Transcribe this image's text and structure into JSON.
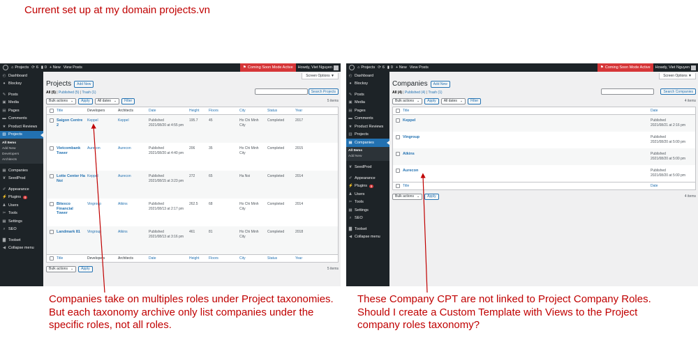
{
  "annotations": {
    "top_note": "Current set up at my domain projects.vn",
    "left_note": "Companies take on multiples roles under Project taxonomies. But each taxonomy archive only list companies under the specific roles, not all roles.",
    "right_note": "These Company CPT are not linked to Project Company Roles. Should I create a Custom Template with Views to the Project company roles taxonomy?",
    "color": "#c00000"
  },
  "adminbar": {
    "site": "Projects",
    "updates": "6",
    "comments": "0",
    "new": "+ New",
    "view_posts": "View Posts",
    "coming_soon": "Coming Soon Mode Active",
    "howdy": "Howdy, Viet Nguyen"
  },
  "sidebar": {
    "items": [
      {
        "label": "Dashboard",
        "icon": "dashboard-icon"
      },
      {
        "label": "Blocksy",
        "icon": "blocksy-icon"
      },
      {
        "label": "Posts",
        "icon": "pin-icon"
      },
      {
        "label": "Media",
        "icon": "media-icon"
      },
      {
        "label": "Pages",
        "icon": "pages-icon"
      },
      {
        "label": "Comments",
        "icon": "comment-icon"
      },
      {
        "label": "Product Reviews",
        "icon": "star-icon"
      },
      {
        "label": "Projects",
        "icon": "projects-icon"
      },
      {
        "label": "Companies",
        "icon": "companies-icon"
      },
      {
        "label": "SeedProd",
        "icon": "seedprod-icon"
      },
      {
        "label": "Appearance",
        "icon": "brush-icon"
      },
      {
        "label": "Plugins",
        "icon": "plugin-icon",
        "badge": "6"
      },
      {
        "label": "Users",
        "icon": "users-icon"
      },
      {
        "label": "Tools",
        "icon": "wrench-icon"
      },
      {
        "label": "Settings",
        "icon": "settings-icon"
      },
      {
        "label": "SEO",
        "icon": "seo-icon"
      },
      {
        "label": "Toolset",
        "icon": "toolset-icon"
      },
      {
        "label": "Collapse menu",
        "icon": "collapse-icon"
      }
    ],
    "projects_sub": [
      "All Items",
      "Add New",
      "Developers",
      "Architects"
    ],
    "companies_sub": [
      "All Items",
      "Add New"
    ]
  },
  "common": {
    "screen_options": "Screen Options ▼",
    "add_new": "Add New",
    "bulk_actions": "Bulk actions",
    "apply": "Apply",
    "all_dates": "All dates",
    "filter": "Filter",
    "published": "Published"
  },
  "projects": {
    "title": "Projects",
    "subsubsub": {
      "all": "All (5)",
      "published": "Published (5)",
      "trash": "Trash (1)"
    },
    "search_button": "Search Projects",
    "count": "5 items",
    "columns": [
      "Title",
      "Developers",
      "Architects",
      "Date",
      "Height",
      "Floors",
      "City",
      "Status",
      "Year"
    ],
    "rows": [
      {
        "title": "Saigon Centre 2",
        "developer": "Keppel",
        "architect": "Keppel",
        "date": "2021/08/20 at 4:55 pm",
        "height": "195.7",
        "floors": "45",
        "city": "Ho Chi Minh City",
        "status": "Completed",
        "year": "2017"
      },
      {
        "title": "Vietcombank Tower",
        "developer": "Aurecon",
        "architect": "Aurecon",
        "date": "2021/08/20 at 4:40 pm",
        "height": "206",
        "floors": "35",
        "city": "Ho Chi Minh City",
        "status": "Completed",
        "year": "2015"
      },
      {
        "title": "Lotte Center Ha Noi",
        "developer": "Keppel",
        "architect": "Aurecon",
        "date": "2021/08/15 at 3:23 pm",
        "height": "272",
        "floors": "65",
        "city": "Ha Noi",
        "status": "Completed",
        "year": "2014"
      },
      {
        "title": "Bitexco Financial Tower",
        "developer": "Vingroup",
        "architect": "Atkins",
        "date": "2021/08/13 at 2:17 pm",
        "height": "262.5",
        "floors": "68",
        "city": "Ho Chi Minh City",
        "status": "Completed",
        "year": "2014"
      },
      {
        "title": "Landmark 81",
        "developer": "Vingroup",
        "architect": "Atkins",
        "date": "2021/08/13 at 3:16 pm",
        "height": "461",
        "floors": "81",
        "city": "Ho Chi Minh City",
        "status": "Completed",
        "year": "2018"
      }
    ]
  },
  "companies": {
    "title": "Companies",
    "subsubsub": {
      "all": "All (4)",
      "published": "Published (4)",
      "trash": "Trash (1)"
    },
    "search_button": "Search Companies",
    "count": "4 items",
    "columns": [
      "Title",
      "Date"
    ],
    "rows": [
      {
        "title": "Keppel",
        "date": "2021/08/21 at 2:16 pm"
      },
      {
        "title": "Vingroup",
        "date": "2021/08/20 at 5:00 pm"
      },
      {
        "title": "Atkins",
        "date": "2021/08/20 at 5:00 pm"
      },
      {
        "title": "Aurecon",
        "date": "2021/08/20 at 5:00 pm"
      }
    ]
  }
}
